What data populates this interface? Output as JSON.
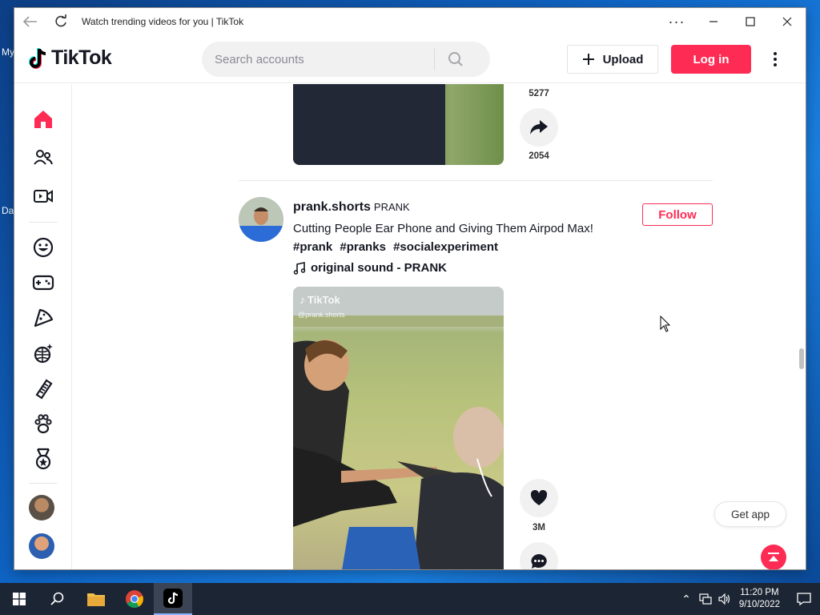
{
  "window": {
    "title": "Watch trending videos for you | TikTok"
  },
  "desktop": {
    "labels": [
      "My",
      "Da"
    ]
  },
  "header": {
    "logo_text": "TikTok",
    "search_placeholder": "Search accounts",
    "upload_label": "Upload",
    "login_label": "Log in"
  },
  "sidebar": {
    "items": [
      {
        "name": "For You",
        "icon": "home-icon",
        "active": true
      },
      {
        "name": "Following",
        "icon": "following-icon"
      },
      {
        "name": "LIVE",
        "icon": "live-icon"
      },
      {
        "name": "Comedy",
        "icon": "smile-icon"
      },
      {
        "name": "Gaming",
        "icon": "gamepad-icon"
      },
      {
        "name": "Food",
        "icon": "pizza-icon"
      },
      {
        "name": "Dance",
        "icon": "disco-ball-icon"
      },
      {
        "name": "Beauty",
        "icon": "comb-icon"
      },
      {
        "name": "Animals",
        "icon": "paw-icon"
      },
      {
        "name": "Sports",
        "icon": "medal-icon"
      }
    ]
  },
  "previous_post": {
    "count_top": "5277",
    "share_count": "2054"
  },
  "post": {
    "username": "prank.shorts",
    "nickname": "PRANK",
    "caption": "Cutting People Ear Phone and Giving Them Airpod Max!",
    "hashtags": [
      "#prank",
      "#pranks",
      "#socialexperiment"
    ],
    "music": "original sound - PRANK",
    "follow_label": "Follow",
    "watermark": "TikTok",
    "watermark_handle": "@prank.shorts",
    "like_count": "3M"
  },
  "floating": {
    "get_app_label": "Get app"
  },
  "taskbar": {
    "time": "11:20 PM",
    "date": "9/10/2022"
  },
  "colors": {
    "brand": "#fe2c55",
    "text": "#161823"
  }
}
